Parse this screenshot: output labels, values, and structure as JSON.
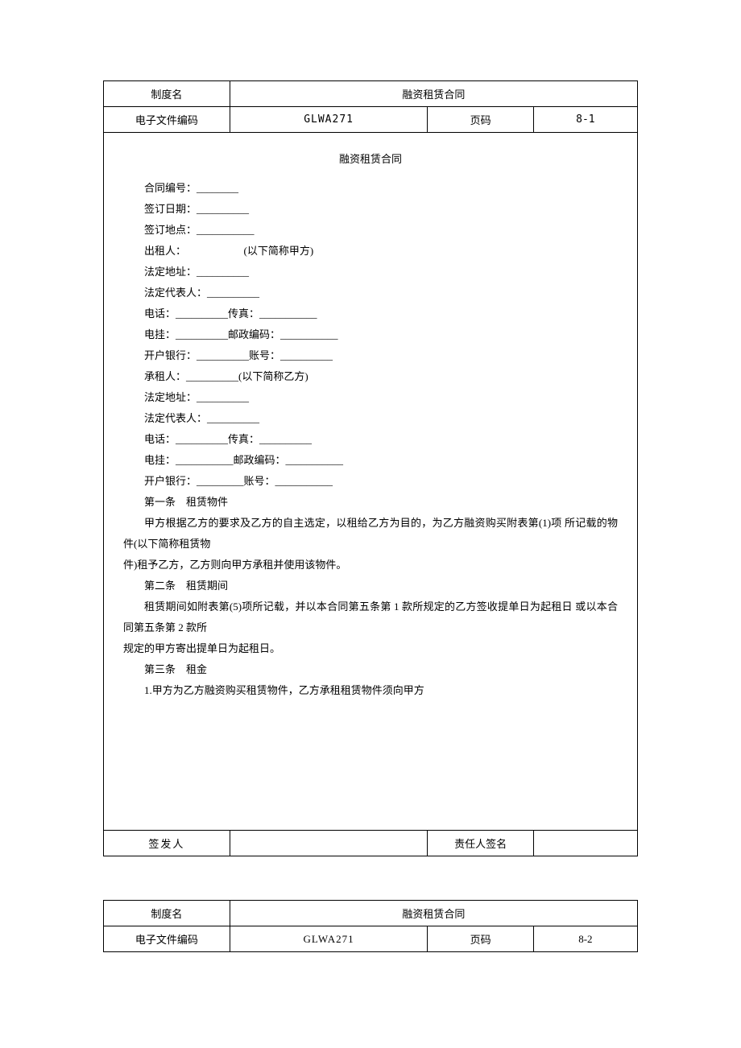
{
  "table1": {
    "header": {
      "systemNameLabel": "制度名",
      "systemNameValue": "融资租赁合同",
      "fileCodeLabel": "电子文件编码",
      "fileCodeValue": "GLWA271",
      "pageLabel": "页码",
      "pageValue": "8-1"
    },
    "content": {
      "title": "融资租赁合同",
      "lines": [
        "合同编号：________",
        "签订日期：__________",
        "签订地点：___________",
        "出租人：　　　　　　(以下简称甲方)",
        "法定地址：__________",
        "法定代表人：__________",
        "电话：__________传真：___________",
        "电挂：__________邮政编码：___________",
        "开户银行：__________账号：__________",
        "承租人：__________(以下简称乙方)",
        "法定地址：__________",
        "法定代表人：__________",
        "电话：__________传真：__________",
        "电挂：___________邮政编码：___________",
        "开户银行：_________账号：___________",
        "第一条　租赁物件"
      ],
      "para1": "甲方根据乙方的要求及乙方的自主选定，以租给乙方为目的，为乙方融资购买附表第(1)项  所记载的物件(以下简称租赁物",
      "para1cont": "件)租予乙方，乙方则向甲方承租并使用该物件。",
      "article2": "第二条　租赁期间",
      "para2": "租赁期间如附表第(5)项所记载，并以本合同第五条第 1 款所规定的乙方签收提单日为起租日  或以本合同第五条第 2 款所",
      "para2cont": "规定的甲方寄出提单日为起租日。",
      "article3": "第三条　租金",
      "para3": "1.甲方为乙方融资购买租赁物件，乙方承租租赁物件须向甲方"
    },
    "footer": {
      "issuerLabel": "签发人",
      "issuerValue": "",
      "signerLabel": "责任人签名",
      "signerValue": ""
    }
  },
  "table2": {
    "systemNameLabel": "制度名",
    "systemNameValue": "融资租赁合同",
    "fileCodeLabel": "电子文件编码",
    "fileCodeValue": "GLWA271",
    "pageLabel": "页码",
    "pageValue": "8-2"
  }
}
